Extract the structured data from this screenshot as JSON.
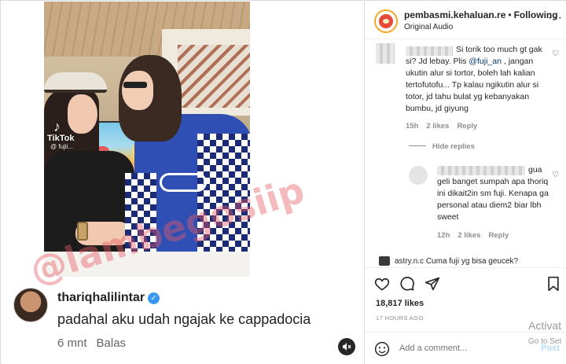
{
  "video_overlay": {
    "tiktok_label": "TikTok",
    "tiktok_glyph": "♪",
    "tiktok_handle": "@ fujii..."
  },
  "comment_overlay": {
    "username": "thariqhalilintar",
    "verified_glyph": "✓",
    "text": "padahal aku udah ngajak ke cappadocia",
    "time": "6 mnt",
    "reply": "Balas",
    "sound_icon": "speaker-muted-icon"
  },
  "watermark": "@lambegosiip",
  "post": {
    "username": "pembasmi.kehaluan.re",
    "follow_status": "Following",
    "audio": "Original Audio",
    "more_icon": "more-dots-icon"
  },
  "comments": [
    {
      "text_before": "Si torik too much gt gak si? Jd lebay. Plis ",
      "mention": "@fuji_an",
      "text_after": " , jangan ukutin alur si tortor, boleh lah kalian tertofutofu... Tp kalau ngikutin alur si totor, jd tahu bulat yg kebanyakan bumbu, jd giyung",
      "time": "15h",
      "likes": "2 likes",
      "reply": "Reply"
    }
  ],
  "hide_replies": "Hide replies",
  "reply_comment": {
    "text_first": "gua",
    "text_rest": "geli banget sumpah apa thoriq ini dikait2in sm fuji. Kenapa ga personal atau diem2 biar lbh sweet",
    "time": "12h",
    "likes": "2 likes",
    "reply": "Reply"
  },
  "cutoff_comment": "astry.n.c Cuma fuji yg bisa geucek?",
  "likes_count": "18,817 likes",
  "posted_ago": "17 HOURS AGO",
  "add_comment_placeholder": "Add a comment...",
  "post_button": "Post",
  "activation": {
    "title": "Activat",
    "subtitle": "Go to Set"
  },
  "colors": {
    "link": "#00376b",
    "verified": "#3897f0",
    "post_button": "#b2dffc",
    "watermark": "#e85a64"
  }
}
